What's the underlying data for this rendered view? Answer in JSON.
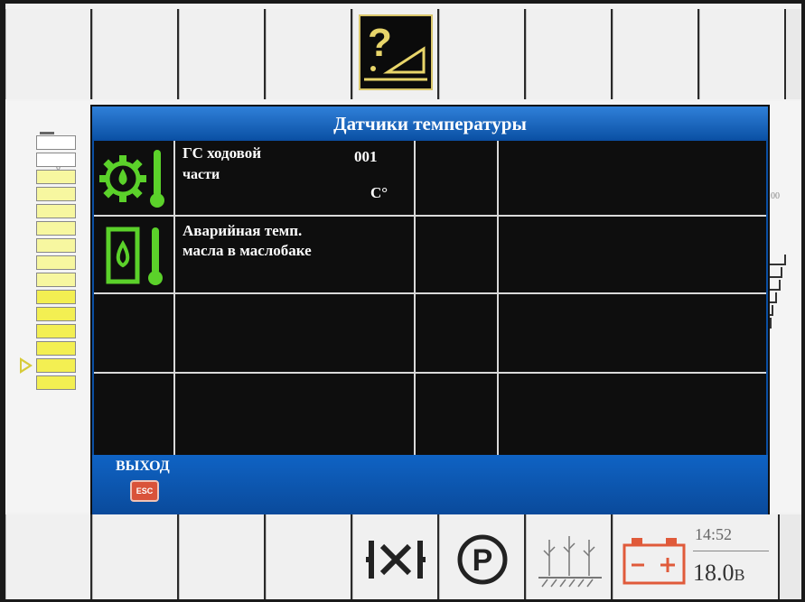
{
  "dialog": {
    "title": "Датчики температуры",
    "rows": [
      {
        "label_line1": "ГС ходовой",
        "label_line2": "части",
        "value": "001",
        "unit": "С°"
      },
      {
        "label_line1": "Аварийная темп.",
        "label_line2": "масла в маслобаке",
        "value": "",
        "unit": ""
      }
    ],
    "exit_label": "ВЫХОД",
    "esc_label": "ESC"
  },
  "gauges": {
    "left_zero": "0",
    "right_max": "100"
  },
  "status": {
    "time": "14:52",
    "voltage_value": "18.0",
    "voltage_unit": "В"
  },
  "icons": {
    "top_help": "help-question-icon",
    "row1": "gear-oil-thermometer-icon",
    "row2": "oil-tank-thermometer-icon",
    "bottom": [
      "neutral-gear-icon",
      "parking-icon",
      "crop-field-icon",
      "battery-icon"
    ]
  },
  "colors": {
    "accent_green": "#5bd12a",
    "dialog_blue": "#0b4fa3",
    "help_yellow": "#d9c66a",
    "battery_red": "#e05a3a"
  }
}
